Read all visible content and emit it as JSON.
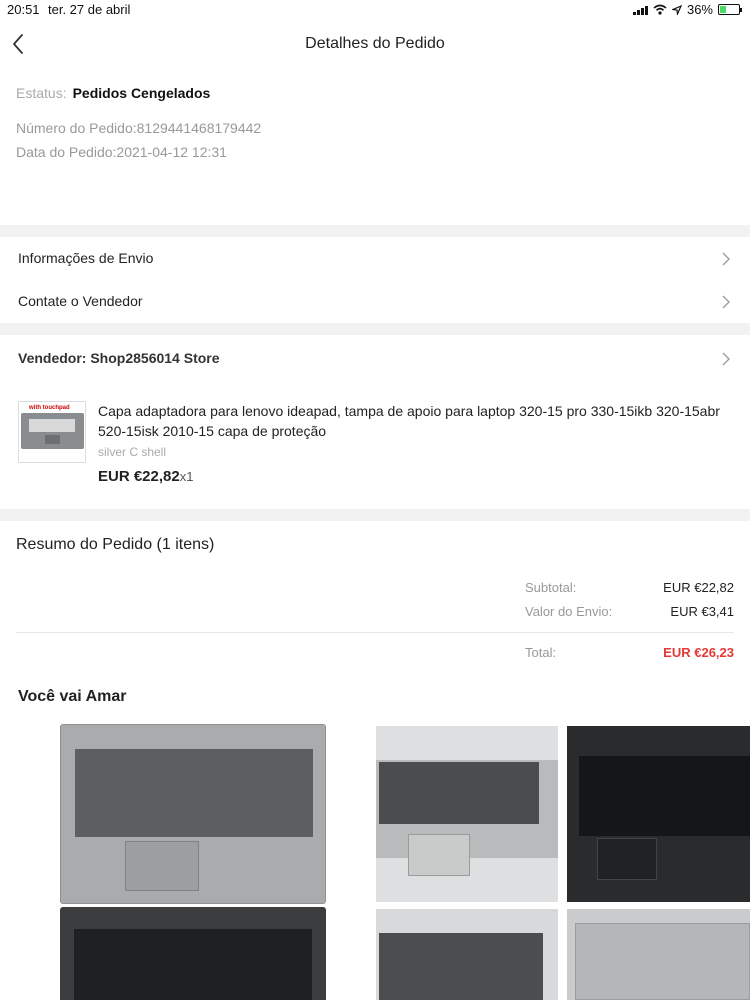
{
  "status_bar": {
    "time": "20:51",
    "date": "ter. 27 de abril",
    "battery": "36%",
    "battery_level": 0.36
  },
  "nav": {
    "title": "Detalhes do Pedido",
    "back_icon": "chevron-left-icon"
  },
  "order": {
    "status_label": "Estatus:",
    "status_value": "Pedidos Cengelados",
    "number_text": "Número do Pedido:8129441468179442",
    "date_text": "Data do Pedido:2021-04-12 12:31"
  },
  "links": [
    {
      "label": "Informações de Envio"
    },
    {
      "label": "Contate o Vendedor"
    }
  ],
  "seller": {
    "label": "Vendedor: Shop2856014 Store"
  },
  "product": {
    "thumb_tag": "with touchpad",
    "title": "Capa adaptadora para lenovo ideapad, tampa de apoio para laptop 320-15 pro 330-15ikb 320-15abr 520-15isk 2010-15 capa de proteção",
    "variant": "silver C shell",
    "price": "EUR €22,82",
    "qty": "x1"
  },
  "summary": {
    "title": "Resumo do Pedido (1 itens)",
    "subtotal_label": "Subtotal:",
    "subtotal_value": "EUR €22,82",
    "shipping_label": "Valor do Envio:",
    "shipping_value": "EUR €3,41",
    "total_label": "Total:",
    "total_value": "EUR €26,23",
    "total_color": "#e53935"
  },
  "recommendations": {
    "title": "Você vai Amar"
  }
}
